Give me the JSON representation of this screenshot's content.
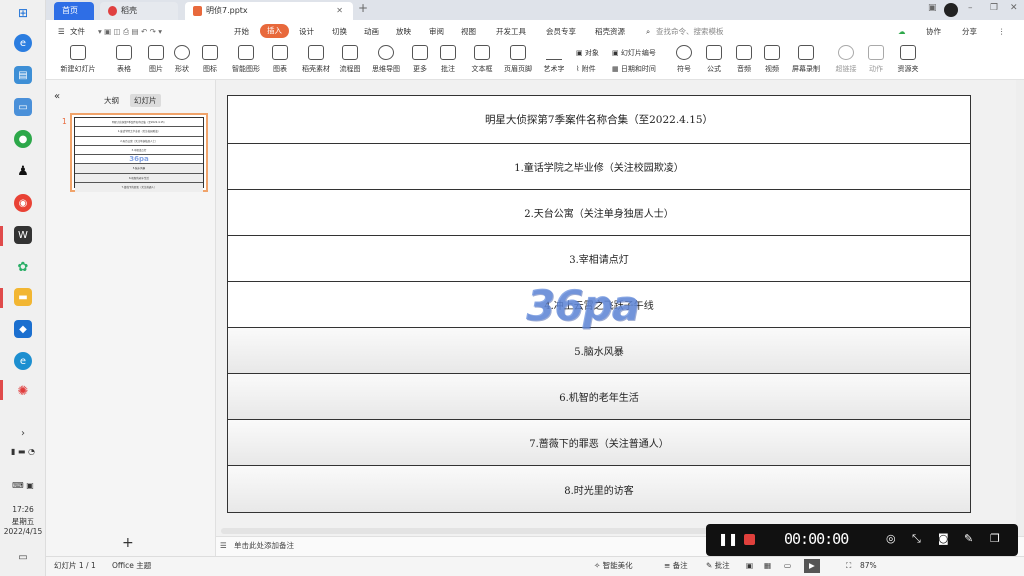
{
  "taskbar": {
    "time": "17:26",
    "weekday": "星期五",
    "date": "2022/4/15"
  },
  "tabs": {
    "home": "首页",
    "doc": "稻壳",
    "current": "明侦7.pptx",
    "add": "+"
  },
  "menu": {
    "file": "文件",
    "items": [
      "开始",
      "插入",
      "设计",
      "切换",
      "动画",
      "放映",
      "审阅",
      "视图",
      "开发工具",
      "会员专享",
      "稻壳资源"
    ],
    "search_placeholder": "查找命令、搜索模板",
    "collab": "协作",
    "share": "分享"
  },
  "ribbon": {
    "buttons": [
      "新建幻灯片",
      "表格",
      "图片",
      "形状",
      "图标",
      "智能图形",
      "图表",
      "稻壳素材",
      "流程图",
      "思维导图",
      "更多",
      "批注",
      "文本框",
      "页眉页脚",
      "艺术字",
      "符号",
      "公式",
      "音频",
      "视频",
      "屏幕录制",
      "超链接",
      "动作",
      "资源夹"
    ],
    "small": [
      "对象",
      "幻灯片编号",
      "附件",
      "日期和时间"
    ]
  },
  "left_panel": {
    "outline_tab": "大纲",
    "slides_tab": "幻灯片",
    "slide_number": "1",
    "add_slide": "+"
  },
  "slide": {
    "title": "明星大侦探第7季案件名称合集（至2022.4.15）",
    "rows": [
      "1.童话学院之毕业修（关注校园欺凌）",
      "2.天台公寓（关注单身独居人士）",
      "3.宰相请点灯",
      "4.冲上云霄之飞跃子午线",
      "5.脑水风暴",
      "6.机智的老年生活",
      "7.蔷薇下的罪恶（关注普通人）",
      "8.时光里的访客"
    ],
    "watermark": "36pa"
  },
  "notes": {
    "placeholder": "单击此处添加备注"
  },
  "statusbar": {
    "slide_count": "幻灯片 1 / 1",
    "theme": "Office 主题",
    "beautify": "智能美化",
    "notes": "备注",
    "comments": "批注",
    "zoom": "87%"
  },
  "recorder": {
    "time": "00:00:00"
  }
}
